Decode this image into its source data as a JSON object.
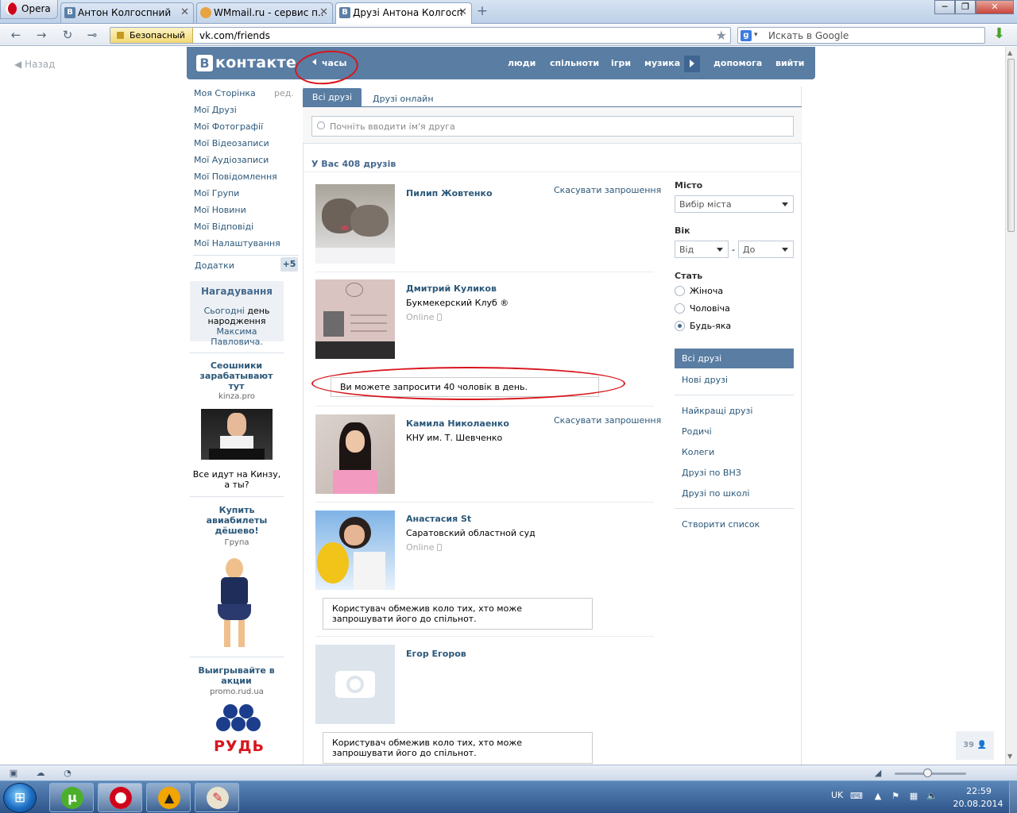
{
  "browser": {
    "menu_label": "Opera",
    "tabs": [
      {
        "title": "Антон Колгоспний",
        "favicon": "В"
      },
      {
        "title": "WMmail.ru - сервис п...",
        "favicon": ""
      },
      {
        "title": "Друзі Антона Колгосп...",
        "favicon": "В"
      }
    ],
    "secure_label": "Безопасный",
    "url": "vk.com/friends",
    "search_engine": "g",
    "search_placeholder": "Искать в Google"
  },
  "page": {
    "back_label": "Назад",
    "header": {
      "logo_letter": "В",
      "logo_text": "контакте",
      "back_link": "часы",
      "nav": [
        "люди",
        "спільноти",
        "ігри",
        "музика",
        "допомога",
        "вийти"
      ]
    },
    "left_menu": {
      "items": [
        "Моя Сторінка",
        "Мої Друзі",
        "Мої Фотографії",
        "Мої Відеозаписи",
        "Мої Аудіозаписи",
        "Мої Повідомлення",
        "Мої Групи",
        "Мої Новини",
        "Мої Відповіді",
        "Мої Налаштування"
      ],
      "edit_label": "ред.",
      "apps_label": "Додатки",
      "apps_badge": "+5"
    },
    "reminder": {
      "title": "Нагадування",
      "link_today": "Сьогодні",
      "text_mid": " день народження ",
      "link_person": "Максима Павловича."
    },
    "ads": [
      {
        "title": "Сеошники зарабатывают тут",
        "sub": "kinza.pro",
        "text": "Все идут на Кинзу, а ты?"
      },
      {
        "title": "Купить авиабилеты дёшево!",
        "sub": "Група",
        "text": ""
      },
      {
        "title": "Выигрывайте в акции",
        "sub": "promo.rud.ua",
        "logo_text": "РУДЬ"
      }
    ],
    "friends": {
      "tab_all": "Всі друзі",
      "tab_online": "Друзі онлайн",
      "search_placeholder": "Почніть вводити ім'я друга",
      "count_text": "У Вас 408 друзів",
      "list": [
        {
          "name": "Пилип Жовтенко",
          "sub": "",
          "online": "",
          "action": "Скасувати запрошення"
        },
        {
          "name": "Дмитрий Куликов",
          "sub": "Букмекерский Клуб ®",
          "online": "Online",
          "action": ""
        },
        {
          "name": "Камила Николаенко",
          "sub": "КНУ им. Т. Шевченко",
          "online": "",
          "action": "Скасувати запрошення"
        },
        {
          "name": "Анастасия St",
          "sub": "Саратовский областной суд",
          "online": "Online",
          "action": ""
        },
        {
          "name": "Егор Егоров",
          "sub": "",
          "online": "",
          "action": ""
        }
      ],
      "invite_limit_notice": "Ви можете запросити 40 чоловік в день.",
      "restricted_notice": "Користувач обмежив коло тих, хто може запрошувати його до спільнот."
    },
    "filters": {
      "city_label": "Місто",
      "city_select": "Вибір міста",
      "age_label": "Вік",
      "age_from": "Від",
      "age_dash": "-",
      "age_to": "До",
      "gender_label": "Стать",
      "gender_options": [
        "Жіноча",
        "Чоловіча",
        "Будь-яка"
      ],
      "gender_selected": "Будь-яка",
      "lists_active": "Всі друзі",
      "lists": [
        "Нові друзі",
        "Найкращі друзі",
        "Родичі",
        "Колеги",
        "Друзі по ВНЗ",
        "Друзі по школі"
      ],
      "create_list": "Створити список"
    },
    "chat_count": "39"
  },
  "taskbar": {
    "lang": "UK",
    "time": "22:59",
    "date": "20.08.2014"
  },
  "colors": {
    "vk_blue": "#597da3",
    "link": "#2b587a",
    "annotation_red": "#d8161d"
  }
}
